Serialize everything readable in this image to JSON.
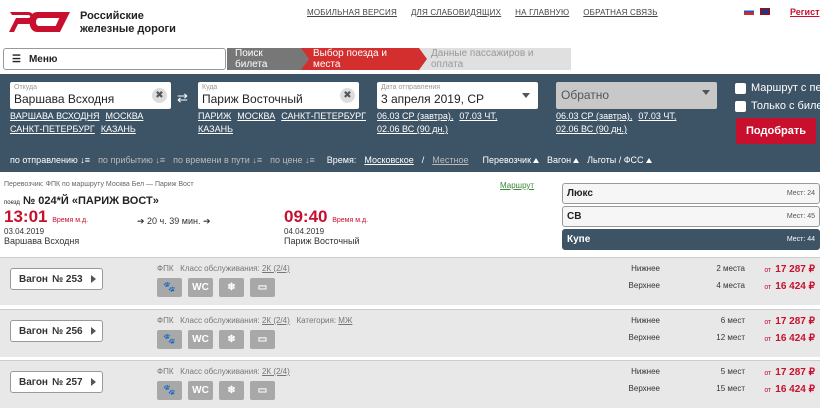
{
  "header": {
    "brand_line1": "Российские",
    "brand_line2": "железные дороги",
    "links": [
      "МОБИЛЬНАЯ ВЕРСИЯ",
      "ДЛЯ СЛАБОВИДЯЩИХ",
      "НА ГЛАВНУЮ",
      "ОБРАТНАЯ СВЯЗЬ"
    ],
    "register": "Регист"
  },
  "menu_label": "Меню",
  "steps": [
    "Поиск билета",
    "Выбор поезда и места",
    "Данные пассажиров и оплата"
  ],
  "search": {
    "from": {
      "label": "Откуда",
      "value": "Варшава Всходня",
      "quick": [
        "ВАРШАВА ВСХОДНЯ",
        "МОСКВА",
        "САНКТ-ПЕТЕРБУРГ",
        "КАЗАНЬ"
      ]
    },
    "to": {
      "label": "Куда",
      "value": "Париж Восточный",
      "quick": [
        "ПАРИЖ",
        "МОСКВА",
        "САНКТ-ПЕТЕРБУРГ",
        "КАЗАНЬ"
      ]
    },
    "date": {
      "label": "Дата отправления",
      "value": "3 апреля 2019, СР",
      "quick": [
        "06.03 СР (завтра),",
        "07.03 ЧТ,",
        "02.06 ВС (90 дн.)"
      ]
    },
    "return": {
      "placeholder": "Обратно",
      "quick": [
        "06.03 СР (завтра),",
        "07.03 ЧТ,",
        "02.06 ВС (90 дн.)"
      ]
    },
    "cb_route": "Маршрут с пер",
    "cb_only": "Только с билет",
    "find": "Подобрать"
  },
  "sort": {
    "by_departure": "по отправлению",
    "by_arrival": "по прибытию",
    "by_travel": "по времени в пути",
    "by_price": "по цене",
    "time_label": "Время:",
    "moscow": "Московское",
    "local": "Местное",
    "carrier": "Перевозчик",
    "wagon": "Вагон",
    "benefits": "Льготы / ФСС"
  },
  "train": {
    "meta": "Перевозчик: ФПК    по маршруту Москва Бел — Париж Вост",
    "route_link": "Маршрут",
    "prefix": "поезд",
    "number": "№ 024*Й «ПАРИЖ ВОСТ»",
    "dep_time": "13:01",
    "dep_note": "Время м.д.",
    "dep_date": "03.04.2019",
    "dep_station": "Варшава Всходня",
    "duration": "20 ч. 39 мин.",
    "arr_time": "09:40",
    "arr_note": "Время м.д.",
    "arr_date": "04.04.2019",
    "arr_station": "Париж Восточный"
  },
  "classes": [
    {
      "name": "Люкс",
      "seats": "Мест: 24"
    },
    {
      "name": "СВ",
      "seats": "Мест: 45"
    },
    {
      "name": "Купе",
      "seats": "Мест: 44"
    }
  ],
  "wagons": [
    {
      "label": "Вагон",
      "num": "№ 253",
      "carrier": "ФПК",
      "svc_label": "Класс обслуживания:",
      "svc": "2К (2/4)",
      "cat_label": "",
      "cat": "",
      "rows": [
        {
          "type": "Нижнее",
          "count": "2 места",
          "price": "17 287 ₽"
        },
        {
          "type": "Верхнее",
          "count": "4 места",
          "price": "16 424 ₽"
        }
      ]
    },
    {
      "label": "Вагон",
      "num": "№ 256",
      "carrier": "ФПК",
      "svc_label": "Класс обслуживания:",
      "svc": "2К (2/4)",
      "cat_label": "Категория:",
      "cat": "МЖ",
      "rows": [
        {
          "type": "Нижнее",
          "count": "6 мест",
          "price": "17 287 ₽"
        },
        {
          "type": "Верхнее",
          "count": "12 мест",
          "price": "16 424 ₽"
        }
      ]
    },
    {
      "label": "Вагон",
      "num": "№ 257",
      "carrier": "ФПК",
      "svc_label": "Класс обслуживания:",
      "svc": "2К (2/4)",
      "cat_label": "",
      "cat": "",
      "rows": [
        {
          "type": "Нижнее",
          "count": "5 мест",
          "price": "17 287 ₽"
        },
        {
          "type": "Верхнее",
          "count": "15 мест",
          "price": "16 424 ₽"
        }
      ]
    }
  ],
  "price_prefix": "от",
  "icons": [
    "animal-icon",
    "wc-icon",
    "ac-icon",
    "linen-icon"
  ],
  "colors": {
    "accent": "#c8102e",
    "panel": "#3d5366"
  }
}
